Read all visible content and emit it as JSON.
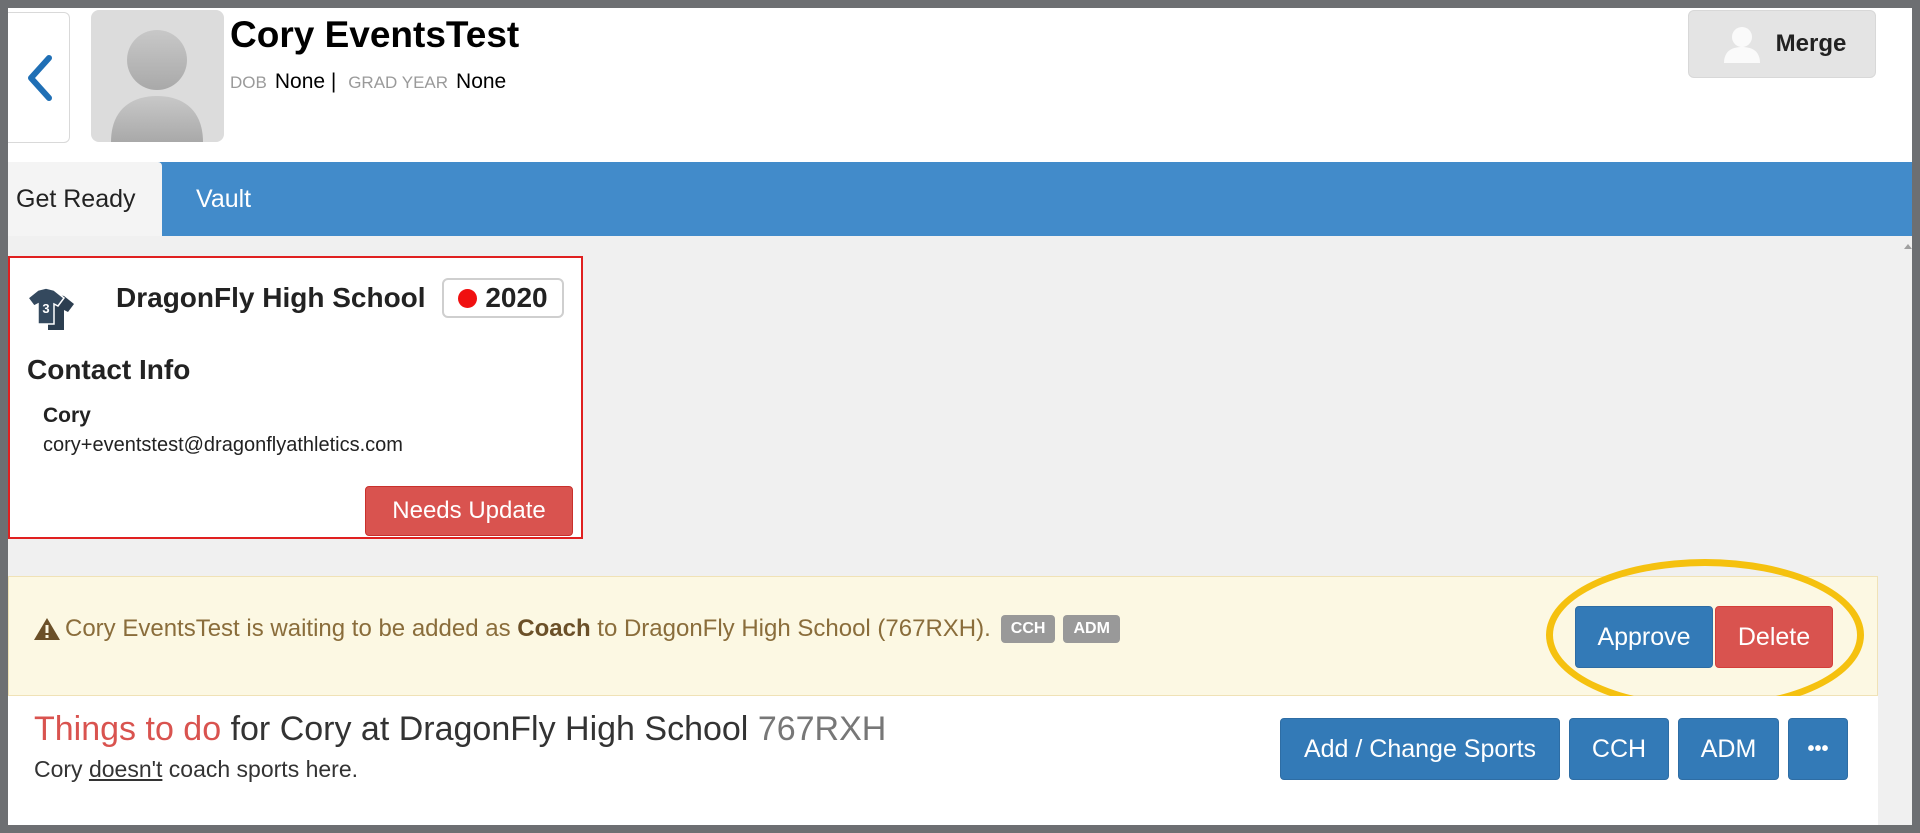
{
  "header": {
    "name": "Cory EventsTest",
    "dob_label": "DOB",
    "dob_value": "None",
    "separator": "|",
    "grad_label": "GRAD YEAR",
    "grad_value": "None",
    "merge_label": "Merge"
  },
  "tabs": [
    {
      "label": "Get Ready"
    },
    {
      "label": "Vault"
    }
  ],
  "school_card": {
    "jersey_number": "3",
    "school_name": "DragonFly High School",
    "year": "2020",
    "contact_title": "Contact Info",
    "contact_name": "Cory",
    "contact_email": "cory+eventstest@dragonflyathletics.com",
    "needs_update_label": "Needs Update"
  },
  "alert": {
    "text_before": "Cory EventsTest is waiting to be added as",
    "role": "Coach",
    "text_after": "to DragonFly High School (767RXH).",
    "badges": [
      "CCH",
      "ADM"
    ],
    "approve_label": "Approve",
    "delete_label": "Delete"
  },
  "todo": {
    "title_highlight": "Things to do",
    "title_middle": "for Cory at DragonFly High School",
    "title_code": "767RXH",
    "sub_before": "Cory",
    "sub_underlined": "doesn't",
    "sub_after": "coach sports here.",
    "buttons": {
      "add_change_sports": "Add / Change Sports",
      "cch": "CCH",
      "adm": "ADM",
      "more": "•••"
    }
  },
  "colors": {
    "tab_bar": "#428bca",
    "primary_button": "#337ab7",
    "danger_button": "#d9534f",
    "alert_bg": "#fcf8e3",
    "highlight_ring": "#f5c10f",
    "card_border": "#e02020"
  },
  "icons": {
    "back": "chevron-left-icon",
    "avatar": "user-silhouette-icon",
    "merge": "user-icon",
    "jersey": "jersey-icon",
    "warning": "warning-icon",
    "status_dot": "red-dot-icon"
  }
}
